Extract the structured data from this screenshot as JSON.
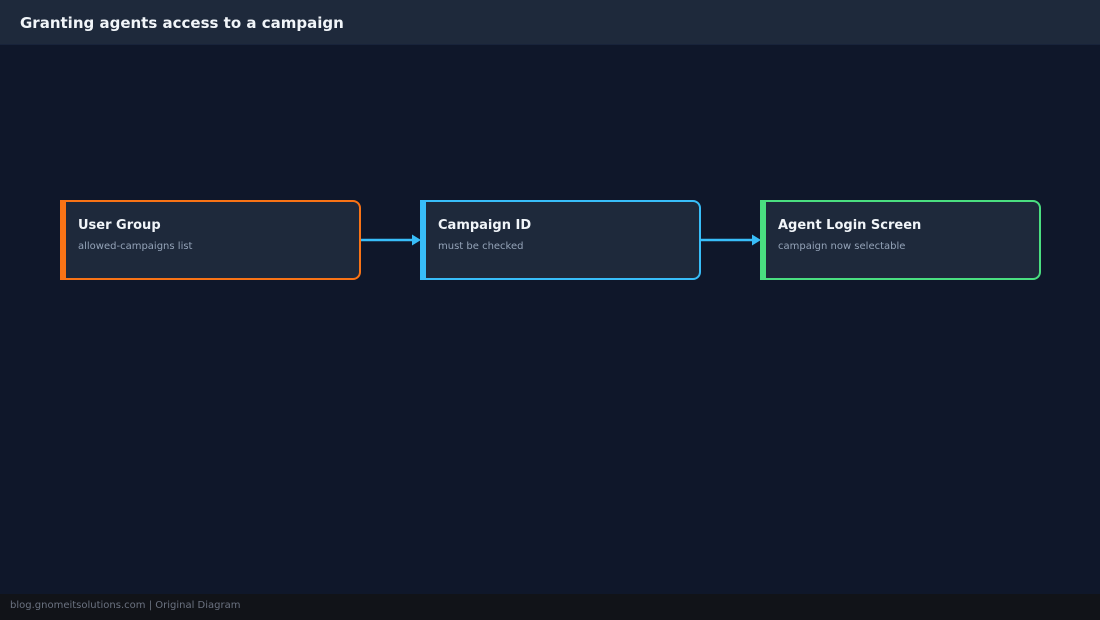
{
  "header": {
    "title": "Granting agents access to a campaign"
  },
  "diagram": {
    "nodes": [
      {
        "title": "User Group",
        "subtitle": "allowed-campaigns list",
        "color": "#f97316"
      },
      {
        "title": "Campaign ID",
        "subtitle": "must be checked",
        "color": "#38bdf8"
      },
      {
        "title": "Agent Login Screen",
        "subtitle": "campaign now selectable",
        "color": "#4ade80"
      }
    ],
    "edge_color": "#38bdf8"
  },
  "footer": {
    "text": "blog.gnomeitsolutions.com | Original Diagram"
  }
}
